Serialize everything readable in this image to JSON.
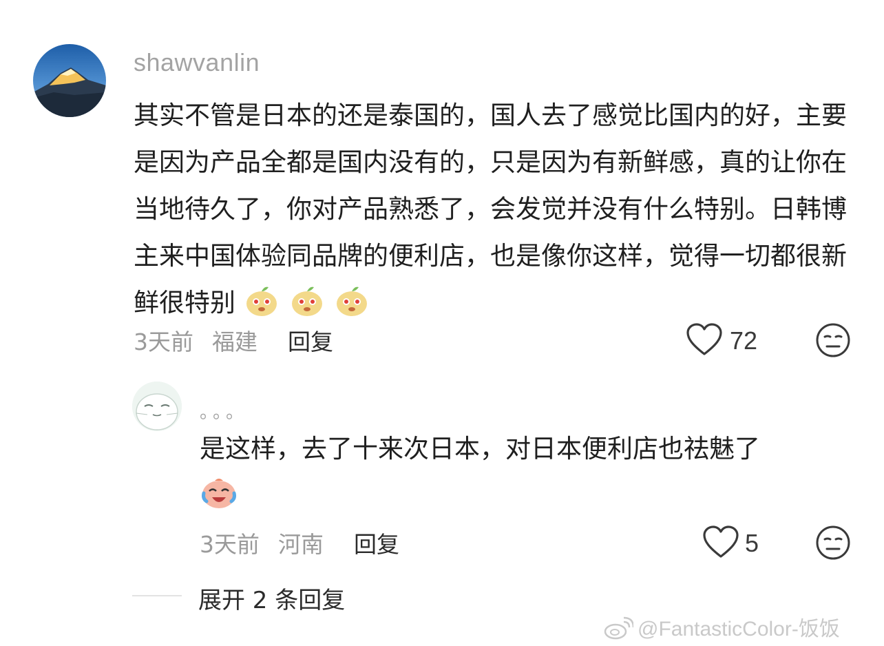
{
  "comment": {
    "username": "shawvanlin",
    "text": "其实不管是日本的还是泰国的，国人去了感觉比国内的好，主要是因为产品全都是国内没有的，只是因为有新鲜感，真的让你在当地待久了，你对产品熟悉了，会发觉并没有什么特别。日韩博主来中国体验同品牌的便利店，也是像你这样，觉得一切都很新鲜很特别",
    "emojis": [
      "pear-face-emoji",
      "pear-face-emoji",
      "pear-face-emoji"
    ],
    "time": "3天前",
    "location": "福建",
    "reply_label": "回复",
    "likes": "72"
  },
  "reply": {
    "username": "。。。",
    "text": "是这样，去了十来次日本，对日本便利店也祛魅了",
    "emoji": "laugh-cry-emoji",
    "time": "3天前",
    "location": "河南",
    "reply_label": "回复",
    "likes": "5"
  },
  "expand_label": "展开 2 条回复",
  "watermark": "@FantasticColor-饭饭",
  "colors": {
    "meta": "#9a9a9a",
    "text": "#1f1f1f",
    "username": "#a3a3a3"
  }
}
